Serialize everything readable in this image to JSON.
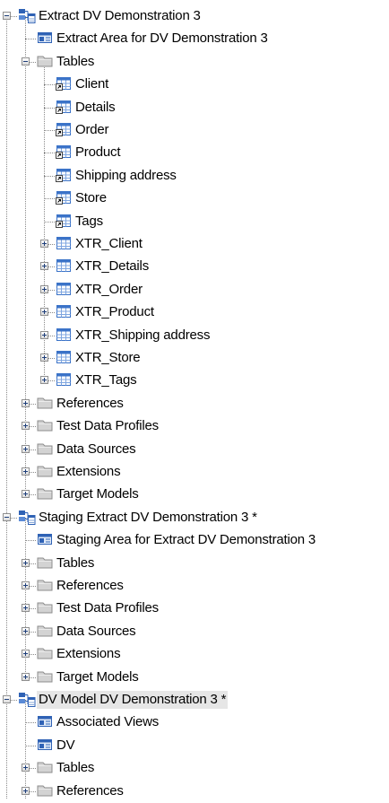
{
  "tree": {
    "nodes": [
      {
        "label": "Extract DV Demonstration 3",
        "icon": "model-icon",
        "expander": "expanded",
        "depth": 0
      },
      {
        "label": "Extract Area for DV Demonstration 3",
        "icon": "area-icon",
        "expander": "none",
        "depth": 1
      },
      {
        "label": "Tables",
        "icon": "folder-icon",
        "expander": "expanded",
        "depth": 1
      },
      {
        "label": "Client",
        "icon": "view-table-icon",
        "expander": "none",
        "depth": 2
      },
      {
        "label": "Details",
        "icon": "view-table-icon",
        "expander": "none",
        "depth": 2
      },
      {
        "label": "Order",
        "icon": "view-table-icon",
        "expander": "none",
        "depth": 2
      },
      {
        "label": "Product",
        "icon": "view-table-icon",
        "expander": "none",
        "depth": 2
      },
      {
        "label": "Shipping address",
        "icon": "view-table-icon",
        "expander": "none",
        "depth": 2
      },
      {
        "label": "Store",
        "icon": "view-table-icon",
        "expander": "none",
        "depth": 2
      },
      {
        "label": "Tags",
        "icon": "view-table-icon",
        "expander": "none",
        "depth": 2
      },
      {
        "label": "XTR_Client",
        "icon": "table-icon",
        "expander": "collapsed",
        "depth": 2
      },
      {
        "label": "XTR_Details",
        "icon": "table-icon",
        "expander": "collapsed",
        "depth": 2
      },
      {
        "label": "XTR_Order",
        "icon": "table-icon",
        "expander": "collapsed",
        "depth": 2
      },
      {
        "label": "XTR_Product",
        "icon": "table-icon",
        "expander": "collapsed",
        "depth": 2
      },
      {
        "label": "XTR_Shipping address",
        "icon": "table-icon",
        "expander": "collapsed",
        "depth": 2
      },
      {
        "label": "XTR_Store",
        "icon": "table-icon",
        "expander": "collapsed",
        "depth": 2
      },
      {
        "label": "XTR_Tags",
        "icon": "table-icon",
        "expander": "collapsed",
        "depth": 2
      },
      {
        "label": "References",
        "icon": "folder-icon",
        "expander": "collapsed",
        "depth": 1
      },
      {
        "label": "Test Data Profiles",
        "icon": "folder-icon",
        "expander": "collapsed",
        "depth": 1
      },
      {
        "label": "Data Sources",
        "icon": "folder-icon",
        "expander": "collapsed",
        "depth": 1
      },
      {
        "label": "Extensions",
        "icon": "folder-icon",
        "expander": "collapsed",
        "depth": 1
      },
      {
        "label": "Target Models",
        "icon": "folder-icon",
        "expander": "collapsed",
        "depth": 1
      },
      {
        "label": "Staging Extract DV Demonstration 3 *",
        "icon": "model-icon",
        "expander": "expanded",
        "depth": 0
      },
      {
        "label": "Staging Area for Extract DV Demonstration 3",
        "icon": "area-icon",
        "expander": "none",
        "depth": 1
      },
      {
        "label": "Tables",
        "icon": "folder-icon",
        "expander": "collapsed",
        "depth": 1
      },
      {
        "label": "References",
        "icon": "folder-icon",
        "expander": "collapsed",
        "depth": 1
      },
      {
        "label": "Test Data Profiles",
        "icon": "folder-icon",
        "expander": "collapsed",
        "depth": 1
      },
      {
        "label": "Data Sources",
        "icon": "folder-icon",
        "expander": "collapsed",
        "depth": 1
      },
      {
        "label": "Extensions",
        "icon": "folder-icon",
        "expander": "collapsed",
        "depth": 1
      },
      {
        "label": "Target Models",
        "icon": "folder-icon",
        "expander": "collapsed",
        "depth": 1
      },
      {
        "label": "DV Model DV Demonstration 3 *",
        "icon": "model-icon",
        "expander": "expanded",
        "depth": 0,
        "selected": true
      },
      {
        "label": "Associated Views",
        "icon": "area-icon",
        "expander": "none",
        "depth": 1
      },
      {
        "label": "DV",
        "icon": "area-icon",
        "expander": "none",
        "depth": 1
      },
      {
        "label": "Tables",
        "icon": "folder-icon",
        "expander": "collapsed",
        "depth": 1
      },
      {
        "label": "References",
        "icon": "folder-icon",
        "expander": "collapsed",
        "depth": 1
      }
    ]
  },
  "colors": {
    "selection_background": "#e6e6e6",
    "folder_fill": "#d3d3d3",
    "table_grid_blue": "#3b73c8",
    "model_icon_blue": "#2f62b5"
  }
}
